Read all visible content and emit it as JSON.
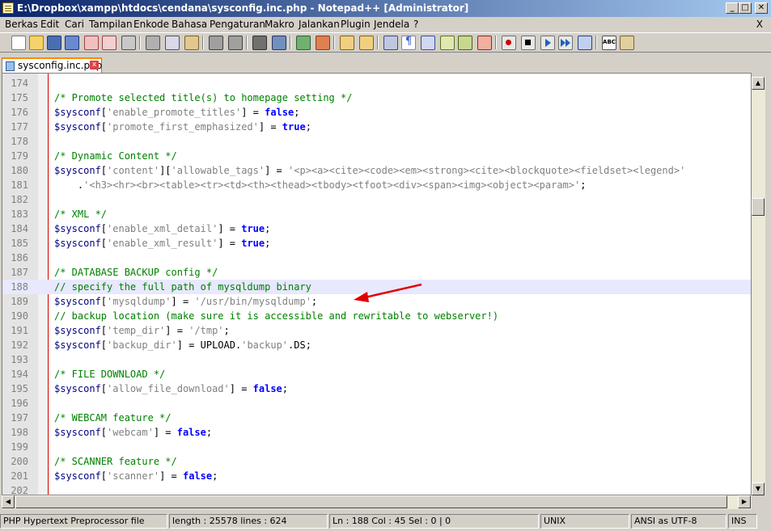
{
  "window": {
    "title": "E:\\Dropbox\\xampp\\htdocs\\cendana\\sysconfig.inc.php - Notepad++ [Administrator]",
    "min": "_",
    "max": "□",
    "close": "✕"
  },
  "menu": {
    "items": [
      "Berkas",
      "Edit",
      "Cari",
      "Tampilan",
      "Enkode",
      "Bahasa",
      "Pengaturan",
      "Makro",
      "Jalankan",
      "Plugin",
      "Jendela",
      "?"
    ],
    "close": "X"
  },
  "tab": {
    "label": "sysconfig.inc.php",
    "close": "x"
  },
  "editor": {
    "highlight_line": 188,
    "lines": [
      {
        "n": "174",
        "t": []
      },
      {
        "n": "175",
        "t": [
          [
            "c-cmt",
            "/* Promote selected title(s) to homepage setting */"
          ]
        ]
      },
      {
        "n": "176",
        "t": [
          [
            "c-var",
            "$sysconf"
          ],
          [
            "c-op",
            "["
          ],
          [
            "c-str",
            "'enable_promote_titles'"
          ],
          [
            "c-op",
            "] = "
          ],
          [
            "c-kw",
            "false"
          ],
          [
            "c-op",
            ";"
          ]
        ]
      },
      {
        "n": "177",
        "t": [
          [
            "c-var",
            "$sysconf"
          ],
          [
            "c-op",
            "["
          ],
          [
            "c-str",
            "'promote_first_emphasized'"
          ],
          [
            "c-op",
            "] = "
          ],
          [
            "c-kw",
            "true"
          ],
          [
            "c-op",
            ";"
          ]
        ]
      },
      {
        "n": "178",
        "t": []
      },
      {
        "n": "179",
        "t": [
          [
            "c-cmt",
            "/* Dynamic Content */"
          ]
        ]
      },
      {
        "n": "180",
        "t": [
          [
            "c-var",
            "$sysconf"
          ],
          [
            "c-op",
            "["
          ],
          [
            "c-str",
            "'content'"
          ],
          [
            "c-op",
            "]["
          ],
          [
            "c-str",
            "'allowable_tags'"
          ],
          [
            "c-op",
            "] = "
          ],
          [
            "c-str",
            "'<p><a><cite><code><em><strong><cite><blockquote><fieldset><legend>'"
          ]
        ]
      },
      {
        "n": "181",
        "t": [
          [
            "c-op",
            "    ."
          ],
          [
            "c-str",
            "'<h3><hr><br><table><tr><td><th><thead><tbody><tfoot><div><span><img><object><param>'"
          ],
          [
            "c-op",
            ";"
          ]
        ]
      },
      {
        "n": "182",
        "t": []
      },
      {
        "n": "183",
        "t": [
          [
            "c-cmt",
            "/* XML */"
          ]
        ]
      },
      {
        "n": "184",
        "t": [
          [
            "c-var",
            "$sysconf"
          ],
          [
            "c-op",
            "["
          ],
          [
            "c-str",
            "'enable_xml_detail'"
          ],
          [
            "c-op",
            "] = "
          ],
          [
            "c-kw",
            "true"
          ],
          [
            "c-op",
            ";"
          ]
        ]
      },
      {
        "n": "185",
        "t": [
          [
            "c-var",
            "$sysconf"
          ],
          [
            "c-op",
            "["
          ],
          [
            "c-str",
            "'enable_xml_result'"
          ],
          [
            "c-op",
            "] = "
          ],
          [
            "c-kw",
            "true"
          ],
          [
            "c-op",
            ";"
          ]
        ]
      },
      {
        "n": "186",
        "t": []
      },
      {
        "n": "187",
        "t": [
          [
            "c-cmt",
            "/* DATABASE BACKUP config */"
          ]
        ]
      },
      {
        "n": "188",
        "t": [
          [
            "c-cmt",
            "// specify the full path of mysqldump binary"
          ]
        ]
      },
      {
        "n": "189",
        "t": [
          [
            "c-var",
            "$sysconf"
          ],
          [
            "c-op",
            "["
          ],
          [
            "c-str",
            "'mysqldump'"
          ],
          [
            "c-op",
            "] = "
          ],
          [
            "c-str",
            "'/usr/bin/mysqldump'"
          ],
          [
            "c-op",
            ";"
          ]
        ]
      },
      {
        "n": "190",
        "t": [
          [
            "c-cmt",
            "// backup location (make sure it is accessible and rewritable to webserver!)"
          ]
        ]
      },
      {
        "n": "191",
        "t": [
          [
            "c-var",
            "$sysconf"
          ],
          [
            "c-op",
            "["
          ],
          [
            "c-str",
            "'temp_dir'"
          ],
          [
            "c-op",
            "] = "
          ],
          [
            "c-str",
            "'/tmp'"
          ],
          [
            "c-op",
            ";"
          ]
        ]
      },
      {
        "n": "192",
        "t": [
          [
            "c-var",
            "$sysconf"
          ],
          [
            "c-op",
            "["
          ],
          [
            "c-str",
            "'backup_dir'"
          ],
          [
            "c-op",
            "] = UPLOAD."
          ],
          [
            "c-str",
            "'backup'"
          ],
          [
            "c-op",
            ".DS;"
          ]
        ]
      },
      {
        "n": "193",
        "t": []
      },
      {
        "n": "194",
        "t": [
          [
            "c-cmt",
            "/* FILE DOWNLOAD */"
          ]
        ]
      },
      {
        "n": "195",
        "t": [
          [
            "c-var",
            "$sysconf"
          ],
          [
            "c-op",
            "["
          ],
          [
            "c-str",
            "'allow_file_download'"
          ],
          [
            "c-op",
            "] = "
          ],
          [
            "c-kw",
            "false"
          ],
          [
            "c-op",
            ";"
          ]
        ]
      },
      {
        "n": "196",
        "t": []
      },
      {
        "n": "197",
        "t": [
          [
            "c-cmt",
            "/* WEBCAM feature */"
          ]
        ]
      },
      {
        "n": "198",
        "t": [
          [
            "c-var",
            "$sysconf"
          ],
          [
            "c-op",
            "["
          ],
          [
            "c-str",
            "'webcam'"
          ],
          [
            "c-op",
            "] = "
          ],
          [
            "c-kw",
            "false"
          ],
          [
            "c-op",
            ";"
          ]
        ]
      },
      {
        "n": "199",
        "t": []
      },
      {
        "n": "200",
        "t": [
          [
            "c-cmt",
            "/* SCANNER feature */"
          ]
        ]
      },
      {
        "n": "201",
        "t": [
          [
            "c-var",
            "$sysconf"
          ],
          [
            "c-op",
            "["
          ],
          [
            "c-str",
            "'scanner'"
          ],
          [
            "c-op",
            "] = "
          ],
          [
            "c-kw",
            "false"
          ],
          [
            "c-op",
            ";"
          ]
        ]
      },
      {
        "n": "202",
        "t": []
      }
    ]
  },
  "status": {
    "filetype": "PHP Hypertext Preprocessor file",
    "length": "length : 25578   lines : 624",
    "position": "Ln : 188   Col : 45   Sel : 0 | 0",
    "eol": "UNIX",
    "encoding": "ANSI as UTF-8",
    "mode": "INS"
  },
  "colors": {
    "accent_arrow": "#e00000",
    "comment": "#008000",
    "keyword": "#0000ff",
    "string": "#808080"
  },
  "toolbar_icons": [
    "new-file-icon",
    "open-file-icon",
    "save-icon",
    "save-all-icon",
    "close-icon",
    "close-all-icon",
    "print-icon",
    "cut-icon",
    "copy-icon",
    "paste-icon",
    "undo-icon",
    "redo-icon",
    "find-icon",
    "replace-icon",
    "zoom-in-icon",
    "zoom-out-icon",
    "sync-v-icon",
    "sync-h-icon",
    "word-wrap-icon",
    "show-all-chars-icon",
    "indent-guide-icon",
    "doc-map-icon",
    "function-list-icon",
    "folder-icon",
    "record-macro-icon",
    "stop-macro-icon",
    "play-macro-icon",
    "run-macro-multiple-icon",
    "save-macro-icon",
    "spellcheck-icon",
    "extra-icon"
  ]
}
